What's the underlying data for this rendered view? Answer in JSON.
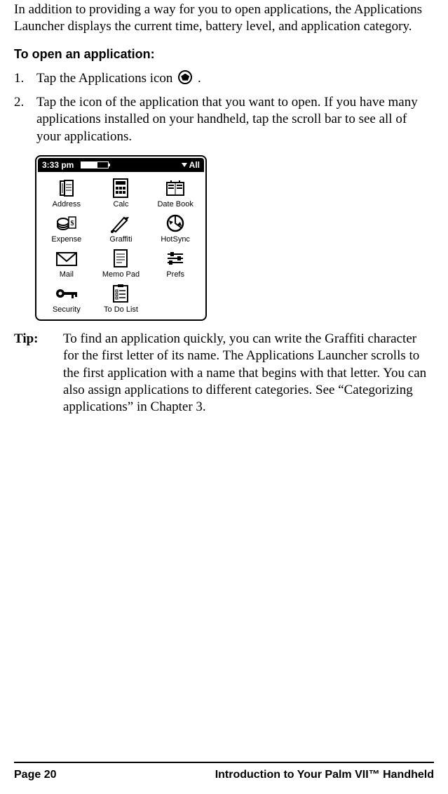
{
  "intro": "In addition to providing a way for you to open applications, the Applications Launcher displays the current time, battery level, and application category.",
  "subheading": "To open an application:",
  "step1_a": "Tap the Applications icon ",
  "step1_b": " .",
  "step2": "Tap the icon of the application that you want to open. If you have many applications installed on your handheld, tap the scroll bar to see all of your applications.",
  "palm": {
    "time": "3:33 pm",
    "category": "All",
    "apps": [
      {
        "label": "Address"
      },
      {
        "label": "Calc"
      },
      {
        "label": "Date Book"
      },
      {
        "label": "Expense"
      },
      {
        "label": "Graffiti"
      },
      {
        "label": "HotSync"
      },
      {
        "label": "Mail"
      },
      {
        "label": "Memo Pad"
      },
      {
        "label": "Prefs"
      },
      {
        "label": "Security"
      },
      {
        "label": "To Do List"
      }
    ]
  },
  "tip": {
    "label": "Tip:",
    "body": "To find an application quickly, you can write the Graffiti character for the first letter of its name. The Applications Launcher scrolls to the first application with a name that begins with that letter. You can also assign applications to different categories. See “Categorizing applications” in Chapter 3."
  },
  "footer": {
    "page": "Page 20",
    "title": "Introduction to Your Palm VII™ Handheld"
  }
}
